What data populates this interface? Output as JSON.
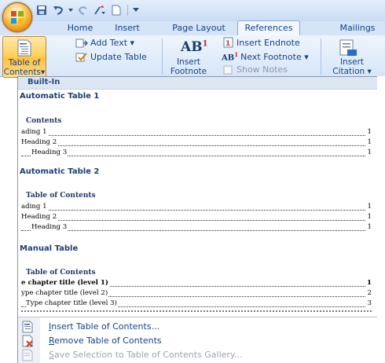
{
  "qat": {
    "icons": [
      "save-icon",
      "undo-icon",
      "redo-icon",
      "format-painter-icon",
      "new-document-icon",
      "customize-arrow-icon"
    ]
  },
  "tabs": [
    {
      "label": "Home"
    },
    {
      "label": "Insert"
    },
    {
      "label": "Page Layout"
    },
    {
      "label": "References",
      "active": true
    },
    {
      "label": "Mailings"
    }
  ],
  "ribbon": {
    "toc_button": {
      "line1": "Table of",
      "line2": "Contents",
      "arrow": "▾"
    },
    "add_text": "Add Text ▾",
    "update_table": "Update Table",
    "insert_footnote": {
      "line1": "Insert",
      "line2": "Footnote",
      "icon_text": "AB",
      "icon_sup": "1"
    },
    "insert_endnote": "Insert Endnote",
    "next_footnote": "Next Footnote ▾",
    "show_notes": "Show Notes",
    "insert_citation": {
      "line1": "Insert",
      "line2": "Citation ▾"
    }
  },
  "gallery": {
    "header": "Built-In",
    "sections": [
      {
        "title": "Automatic Table 1",
        "heading": "Contents",
        "lines": [
          {
            "text": "ading 1",
            "page": "1",
            "indent": 0
          },
          {
            "text": "Heading 2",
            "page": "1",
            "indent": 0
          },
          {
            "text": "Heading 3",
            "page": "1",
            "indent": 1
          }
        ]
      },
      {
        "title": "Automatic Table 2",
        "heading": "Table of Contents",
        "lines": [
          {
            "text": "ading 1",
            "page": "1",
            "indent": 0
          },
          {
            "text": "Heading 2",
            "page": "1",
            "indent": 0
          },
          {
            "text": "Heading 3",
            "page": "1",
            "indent": 1
          }
        ]
      },
      {
        "title": "Manual Table",
        "heading": "Table of Contents",
        "lines": [
          {
            "text": "e chapter title (level 1)",
            "page": "1",
            "indent": 0,
            "bold": true
          },
          {
            "text": "ype chapter title (level 2)",
            "page": "2",
            "indent": 0
          },
          {
            "text": "Type chapter title (level 3)",
            "page": "3",
            "indent": 1
          }
        ]
      }
    ],
    "menu": {
      "insert_toc": {
        "pre": "",
        "ul": "I",
        "post": "nsert Table of Contents..."
      },
      "remove_toc": {
        "pre": "",
        "ul": "R",
        "post": "emove Table of Contents"
      },
      "save_selection": {
        "pre": "",
        "ul": "S",
        "post": "ave Selection to Table of Contents Gallery..."
      }
    }
  },
  "colors": {
    "accent": "#15428b",
    "highlight": "#ffd161",
    "ribbon_bg": "#dbe8f8"
  }
}
